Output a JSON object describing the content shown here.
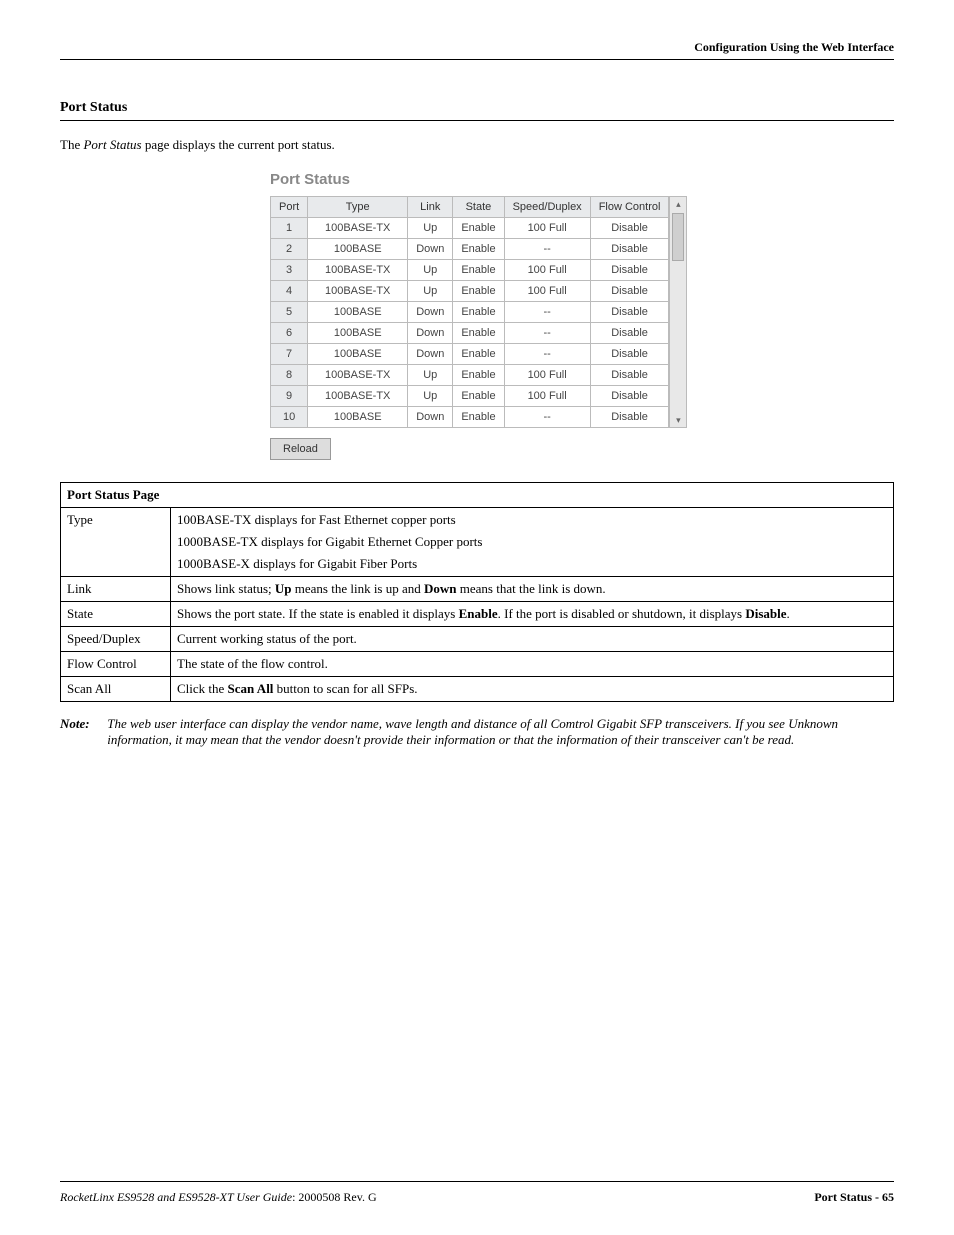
{
  "header": {
    "right": "Configuration Using the Web Interface"
  },
  "section": {
    "title": "Port Status"
  },
  "intro": {
    "prefix": "The ",
    "em": "Port Status",
    "suffix": " page displays the current port status."
  },
  "status_title": "Port Status",
  "status_headers": [
    "Port",
    "Type",
    "Link",
    "State",
    "Speed/Duplex",
    "Flow Control"
  ],
  "status_rows": [
    {
      "port": "1",
      "type": "100BASE-TX",
      "link": "Up",
      "state": "Enable",
      "sd": "100 Full",
      "fc": "Disable"
    },
    {
      "port": "2",
      "type": "100BASE",
      "link": "Down",
      "state": "Enable",
      "sd": "--",
      "fc": "Disable"
    },
    {
      "port": "3",
      "type": "100BASE-TX",
      "link": "Up",
      "state": "Enable",
      "sd": "100 Full",
      "fc": "Disable"
    },
    {
      "port": "4",
      "type": "100BASE-TX",
      "link": "Up",
      "state": "Enable",
      "sd": "100 Full",
      "fc": "Disable"
    },
    {
      "port": "5",
      "type": "100BASE",
      "link": "Down",
      "state": "Enable",
      "sd": "--",
      "fc": "Disable"
    },
    {
      "port": "6",
      "type": "100BASE",
      "link": "Down",
      "state": "Enable",
      "sd": "--",
      "fc": "Disable"
    },
    {
      "port": "7",
      "type": "100BASE",
      "link": "Down",
      "state": "Enable",
      "sd": "--",
      "fc": "Disable"
    },
    {
      "port": "8",
      "type": "100BASE-TX",
      "link": "Up",
      "state": "Enable",
      "sd": "100 Full",
      "fc": "Disable"
    },
    {
      "port": "9",
      "type": "100BASE-TX",
      "link": "Up",
      "state": "Enable",
      "sd": "100 Full",
      "fc": "Disable"
    },
    {
      "port": "10",
      "type": "100BASE",
      "link": "Down",
      "state": "Enable",
      "sd": "--",
      "fc": "Disable"
    }
  ],
  "reload_label": "Reload",
  "desc": {
    "title": "Port Status Page",
    "rows": {
      "type": {
        "label": "Type",
        "l1": "100BASE-TX displays for Fast Ethernet copper ports",
        "l2": "1000BASE-TX displays for Gigabit Ethernet Copper ports",
        "l3": "1000BASE-X displays for Gigabit Fiber Ports"
      },
      "link": {
        "label": "Link",
        "t1": "Shows link status; ",
        "b1": "Up",
        "t2": " means the link is up and ",
        "b2": "Down",
        "t3": " means that the link is down."
      },
      "state": {
        "label": "State",
        "t1": "Shows the port state. If the state is enabled it displays ",
        "b1": "Enable",
        "t2": ". If the port is disabled or shutdown, it displays ",
        "b2": "Disable",
        "t3": "."
      },
      "speed": {
        "label": "Speed/Duplex",
        "text": "Current working status of the port."
      },
      "flow": {
        "label": "Flow Control",
        "text": "The state of the flow control."
      },
      "scan": {
        "label": "Scan All",
        "t1": "Click the ",
        "b1": "Scan All",
        "t2": " button to scan for all SFPs."
      }
    }
  },
  "note": {
    "label": "Note:",
    "body": "The web user interface can display the vendor name, wave length and distance of all Comtrol Gigabit SFP transceivers. If you see Unknown information, it may mean that the vendor doesn't provide their information or that the information of their transceiver can't be read."
  },
  "footer": {
    "left_em": "RocketLinx ES9528 and ES9528-XT User Guide",
    "left_norm": ": 2000508 Rev. G",
    "right": "Port Status - 65"
  }
}
